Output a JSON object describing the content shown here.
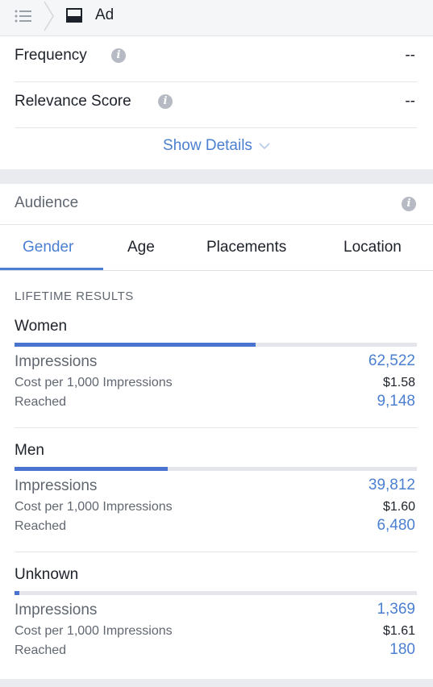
{
  "header": {
    "breadcrumb": "Ad",
    "icons": [
      "list-icon",
      "chevron-right-icon",
      "ad-icon"
    ]
  },
  "summary": {
    "rows": [
      {
        "label": "Frequency",
        "value": "--"
      },
      {
        "label": "Relevance Score",
        "value": "--"
      }
    ],
    "show_details": "Show Details"
  },
  "audience": {
    "title": "Audience",
    "tabs": [
      {
        "label": "Gender",
        "active": true
      },
      {
        "label": "Age",
        "active": false
      },
      {
        "label": "Placements",
        "active": false
      },
      {
        "label": "Location",
        "active": false
      }
    ],
    "section_title": "LIFETIME RESULTS",
    "groups": [
      {
        "name": "Women",
        "bar_fraction": 0.6,
        "metrics": [
          {
            "label": "Impressions",
            "value": "62,522"
          },
          {
            "label": "Cost per 1,000 Impressions",
            "value": "$1.58"
          },
          {
            "label": "Reached",
            "value": "9,148"
          }
        ]
      },
      {
        "name": "Men",
        "bar_fraction": 0.38,
        "metrics": [
          {
            "label": "Impressions",
            "value": "39,812"
          },
          {
            "label": "Cost per 1,000 Impressions",
            "value": "$1.60"
          },
          {
            "label": "Reached",
            "value": "6,480"
          }
        ]
      },
      {
        "name": "Unknown",
        "bar_fraction": 0.012,
        "metrics": [
          {
            "label": "Impressions",
            "value": "1,369"
          },
          {
            "label": "Cost per 1,000 Impressions",
            "value": "$1.61"
          },
          {
            "label": "Reached",
            "value": "180"
          }
        ]
      }
    ]
  },
  "colors": {
    "accent": "#4b7fd1",
    "bar": "#4a74cf",
    "muted": "#606770"
  }
}
